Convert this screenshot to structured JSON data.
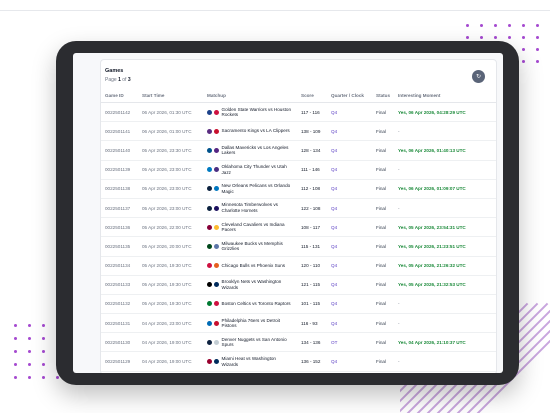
{
  "card": {
    "title": "Games",
    "page_label": "Page",
    "page_current": "1",
    "page_of": "of",
    "page_total": "3",
    "refresh_icon": "refresh-icon"
  },
  "columns": [
    "Game ID",
    "Start Time",
    "Matchup",
    "Score",
    "Quarter / Clock",
    "Status",
    "Interesting Moment"
  ],
  "rows": [
    {
      "id": "0022501142",
      "start": "06 Apr 2026, 01:30 UTC",
      "matchup": "Golden State Warriors vs Houston Rockets",
      "logo1": "#1d428a",
      "logo2": "#ce1141",
      "score": "117 - 116",
      "quarter": "Q4",
      "status": "Final",
      "moment": "Yes, 06 Apr 2026, 04:28:29 UTC"
    },
    {
      "id": "0022501141",
      "start": "06 Apr 2026, 01:00 UTC",
      "matchup": "Sacramento Kings vs LA Clippers",
      "logo1": "#5a2d81",
      "logo2": "#c8102e",
      "score": "138 - 109",
      "quarter": "Q4",
      "status": "Final",
      "moment": "-"
    },
    {
      "id": "0022501140",
      "start": "05 Apr 2026, 23:30 UTC",
      "matchup": "Dallas Mavericks vs Los Angeles Lakers",
      "logo1": "#00538c",
      "logo2": "#552583",
      "score": "128 - 134",
      "quarter": "Q4",
      "status": "Final",
      "moment": "Yes, 06 Apr 2026, 01:40:13 UTC"
    },
    {
      "id": "0022501139",
      "start": "05 Apr 2026, 23:00 UTC",
      "matchup": "Oklahoma City Thunder vs Utah Jazz",
      "logo1": "#007ac1",
      "logo2": "#4b2e83",
      "score": "111 - 146",
      "quarter": "Q4",
      "status": "Final",
      "moment": "-"
    },
    {
      "id": "0022501138",
      "start": "05 Apr 2026, 23:00 UTC",
      "matchup": "New Orleans Pelicans vs Orlando Magic",
      "logo1": "#0c2340",
      "logo2": "#0077c0",
      "score": "112 - 108",
      "quarter": "Q4",
      "status": "Final",
      "moment": "Yes, 06 Apr 2026, 01:09:07 UTC"
    },
    {
      "id": "0022501137",
      "start": "05 Apr 2026, 23:00 UTC",
      "matchup": "Minnesota Timberwolves vs Charlotte Hornets",
      "logo1": "#0c2340",
      "logo2": "#1d1160",
      "score": "122 - 108",
      "quarter": "Q4",
      "status": "Final",
      "moment": "-"
    },
    {
      "id": "0022501136",
      "start": "05 Apr 2026, 22:00 UTC",
      "matchup": "Cleveland Cavaliers vs Indiana Pacers",
      "logo1": "#860038",
      "logo2": "#fdbb30",
      "score": "108 - 117",
      "quarter": "Q4",
      "status": "Final",
      "moment": "Yes, 05 Apr 2026, 23:54:31 UTC"
    },
    {
      "id": "0022501135",
      "start": "05 Apr 2026, 20:00 UTC",
      "matchup": "Milwaukee Bucks vs Memphis Grizzlies",
      "logo1": "#00471b",
      "logo2": "#5d76a9",
      "score": "115 - 131",
      "quarter": "Q4",
      "status": "Final",
      "moment": "Yes, 05 Apr 2026, 21:23:51 UTC"
    },
    {
      "id": "0022501134",
      "start": "05 Apr 2026, 19:30 UTC",
      "matchup": "Chicago Bulls vs Phoenix Suns",
      "logo1": "#ce1141",
      "logo2": "#e56020",
      "score": "120 - 110",
      "quarter": "Q4",
      "status": "Final",
      "moment": "Yes, 05 Apr 2026, 21:26:32 UTC"
    },
    {
      "id": "0022501133",
      "start": "05 Apr 2026, 19:30 UTC",
      "matchup": "Brooklyn Nets vs Washington Wizards",
      "logo1": "#000000",
      "logo2": "#002b5c",
      "score": "121 - 115",
      "quarter": "Q4",
      "status": "Final",
      "moment": "Yes, 05 Apr 2026, 21:32:53 UTC"
    },
    {
      "id": "0022501132",
      "start": "05 Apr 2026, 19:30 UTC",
      "matchup": "Boston Celtics vs Toronto Raptors",
      "logo1": "#007a33",
      "logo2": "#ce1141",
      "score": "101 - 115",
      "quarter": "Q4",
      "status": "Final",
      "moment": "-"
    },
    {
      "id": "0022501131",
      "start": "04 Apr 2026, 23:00 UTC",
      "matchup": "Philadelphia 76ers vs Detroit Pistons",
      "logo1": "#006bb6",
      "logo2": "#c8102e",
      "score": "116 - 93",
      "quarter": "Q4",
      "status": "Final",
      "moment": "-"
    },
    {
      "id": "0022501130",
      "start": "04 Apr 2026, 19:00 UTC",
      "matchup": "Denver Nuggets vs San Antonio Spurs",
      "logo1": "#0e2240",
      "logo2": "#c4ced4",
      "score": "134 - 136",
      "quarter": "OT",
      "status": "Final",
      "moment": "Yes, 04 Apr 2026, 21:10:37 UTC"
    },
    {
      "id": "0022501129",
      "start": "04 Apr 2026, 19:00 UTC",
      "matchup": "Miami Heat vs Washington Wizards",
      "logo1": "#98002e",
      "logo2": "#002b5c",
      "score": "136 - 152",
      "quarter": "Q4",
      "status": "Final",
      "moment": "-"
    }
  ],
  "colors": {
    "accent_purple": "#5b3fc4",
    "moment_green": "#1b8a3a",
    "decoration_dot": "#a54ad0"
  }
}
